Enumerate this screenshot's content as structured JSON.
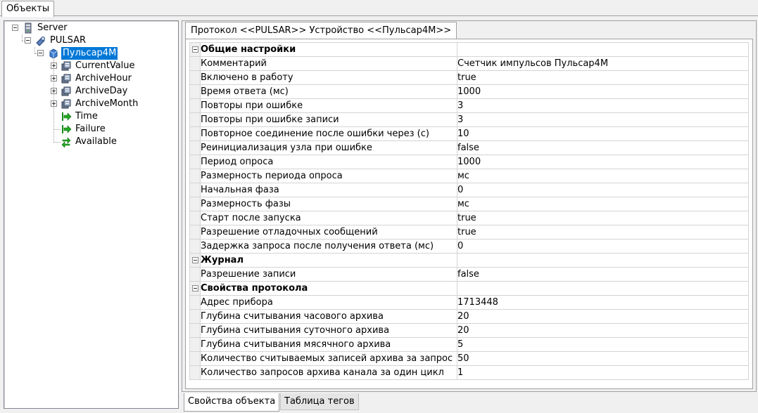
{
  "top_tab": {
    "label": "Объекты"
  },
  "tree": {
    "nodes": [
      {
        "label": "Server",
        "icon": "server-icon"
      },
      {
        "label": "PULSAR",
        "icon": "protocol-icon"
      },
      {
        "label": "Пульсар4М",
        "icon": "device-icon",
        "selected": true
      },
      {
        "label": "CurrentValue",
        "icon": "tag-group-icon"
      },
      {
        "label": "ArchiveHour",
        "icon": "tag-group-icon"
      },
      {
        "label": "ArchiveDay",
        "icon": "tag-group-icon"
      },
      {
        "label": "ArchiveMonth",
        "icon": "tag-group-icon"
      },
      {
        "label": "Time",
        "icon": "green-arrow-icon"
      },
      {
        "label": "Failure",
        "icon": "green-arrow-icon"
      },
      {
        "label": "Available",
        "icon": "bidirectional-arrow-icon"
      }
    ]
  },
  "protocol_tab": {
    "label": "Протокол <<PULSAR>> Устройство <<Пульсар4М>>"
  },
  "grid": {
    "categories": [
      {
        "title": "Общие настройки",
        "rows": [
          {
            "name": "Комментарий",
            "value": "Счетчик импульсов Пульсар4М"
          },
          {
            "name": "Включено в работу",
            "value": "true"
          },
          {
            "name": "Время ответа (мс)",
            "value": "1000"
          },
          {
            "name": "Повторы при ошибке",
            "value": "3"
          },
          {
            "name": "Повторы при ошибке записи",
            "value": "3"
          },
          {
            "name": "Повторное соединение после ошибки через (с)",
            "value": "10"
          },
          {
            "name": "Реинициализация узла при ошибке",
            "value": "false"
          },
          {
            "name": "Период опроса",
            "value": "1000"
          },
          {
            "name": "Размерность периода опроса",
            "value": "мс"
          },
          {
            "name": "Начальная фаза",
            "value": "0"
          },
          {
            "name": "Размерность фазы",
            "value": "мс"
          },
          {
            "name": "Старт после запуска",
            "value": "true"
          },
          {
            "name": "Разрешение отладочных сообщений",
            "value": "true"
          },
          {
            "name": "Задержка запроса после получения ответа (мс)",
            "value": "0"
          }
        ]
      },
      {
        "title": "Журнал",
        "rows": [
          {
            "name": "Разрешение записи",
            "value": "false"
          }
        ]
      },
      {
        "title": "Свойства протокола",
        "rows": [
          {
            "name": "Адрес прибора",
            "value": "1713448"
          },
          {
            "name": "Глубина считывания часового архива",
            "value": "20"
          },
          {
            "name": "Глубина считывания суточного архива",
            "value": "20"
          },
          {
            "name": "Глубина считывания мясячного архива",
            "value": "5"
          },
          {
            "name": "Количество считываемых записей архива за запрос",
            "value": "50"
          },
          {
            "name": "Количество запросов архива канала за один цикл",
            "value": "1"
          }
        ]
      }
    ]
  },
  "bottom_tabs": [
    {
      "label": "Свойства объекта",
      "active": true
    },
    {
      "label": "Таблица тегов",
      "active": false
    }
  ],
  "colors": {
    "selection": "#0078d7",
    "grid_line": "#d4d4d4",
    "panel_bg": "#f0f0f0"
  }
}
